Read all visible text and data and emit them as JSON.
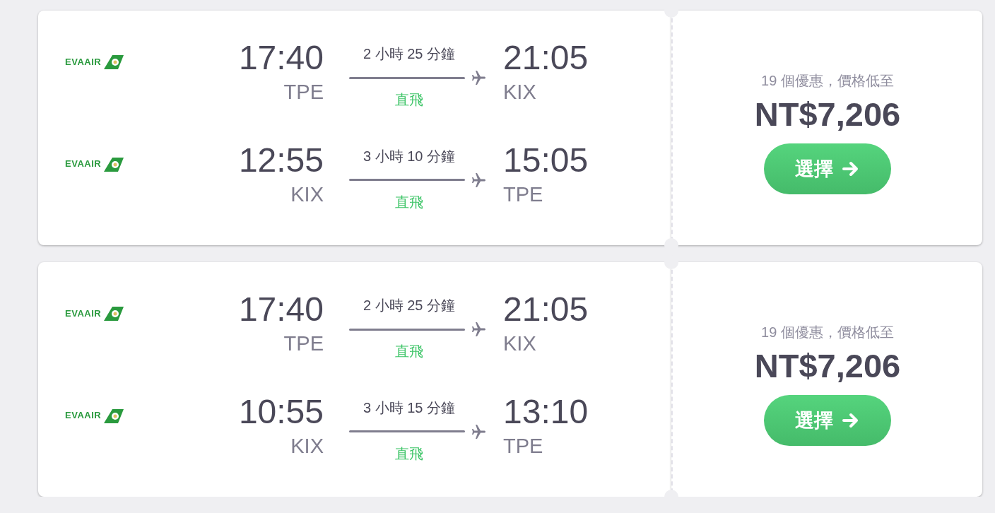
{
  "results": [
    {
      "legs": [
        {
          "airline": "EVAAIR",
          "depart_time": "17:40",
          "depart_code": "TPE",
          "duration": "2 小時 25 分鐘",
          "stops": "直飛",
          "arrive_time": "21:05",
          "arrive_code": "KIX"
        },
        {
          "airline": "EVAAIR",
          "depart_time": "12:55",
          "depart_code": "KIX",
          "duration": "3 小時 10 分鐘",
          "stops": "直飛",
          "arrive_time": "15:05",
          "arrive_code": "TPE"
        }
      ],
      "deals": "19 個優惠，價格低至",
      "price": "NT$7,206",
      "button": "選擇"
    },
    {
      "legs": [
        {
          "airline": "EVAAIR",
          "depart_time": "17:40",
          "depart_code": "TPE",
          "duration": "2 小時 25 分鐘",
          "stops": "直飛",
          "arrive_time": "21:05",
          "arrive_code": "KIX"
        },
        {
          "airline": "EVAAIR",
          "depart_time": "10:55",
          "depart_code": "KIX",
          "duration": "3 小時 15 分鐘",
          "stops": "直飛",
          "arrive_time": "13:10",
          "arrive_code": "TPE"
        }
      ],
      "deals": "19 個優惠，價格低至",
      "price": "NT$7,206",
      "button": "選擇"
    }
  ]
}
